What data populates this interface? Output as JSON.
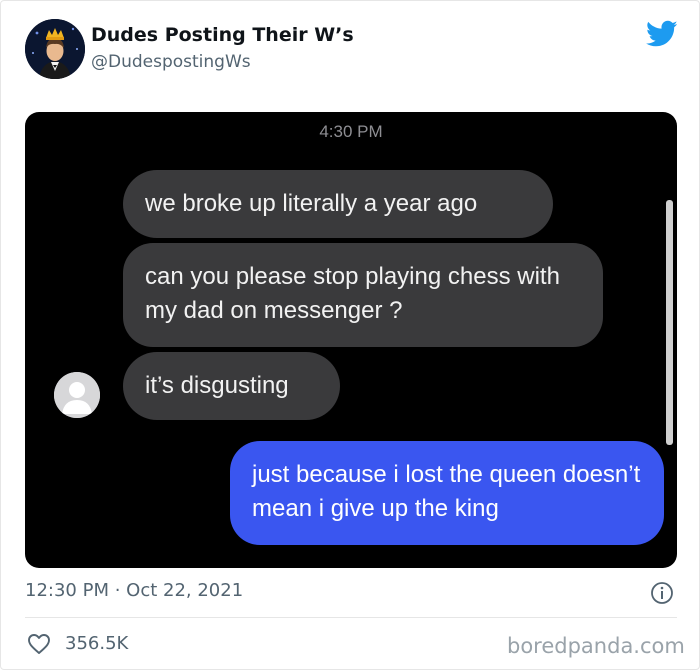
{
  "tweet": {
    "author_name": "Dudes Posting Their W’s",
    "author_handle": "@DudespostingWs",
    "timestamp": "12:30 PM · Oct 22, 2021",
    "likes": "356.5K"
  },
  "screenshot": {
    "time": "4:30 PM",
    "messages": [
      {
        "direction": "incoming",
        "text": "we broke up literally a year ago"
      },
      {
        "direction": "incoming",
        "text": "can you please stop playing chess with my dad on messenger ?"
      },
      {
        "direction": "incoming",
        "text": "it’s disgusting"
      },
      {
        "direction": "outgoing",
        "text": "just because i lost the queen doesn’t mean i give up the king"
      }
    ]
  },
  "watermark": "boredpanda.com",
  "colors": {
    "twitter_blue": "#1d9bf0",
    "outgoing_bubble": "#3a56f0",
    "incoming_bubble": "#3a3a3c"
  },
  "icons": [
    "twitter-bird-icon",
    "info-icon",
    "heart-icon",
    "contact-avatar-icon"
  ]
}
